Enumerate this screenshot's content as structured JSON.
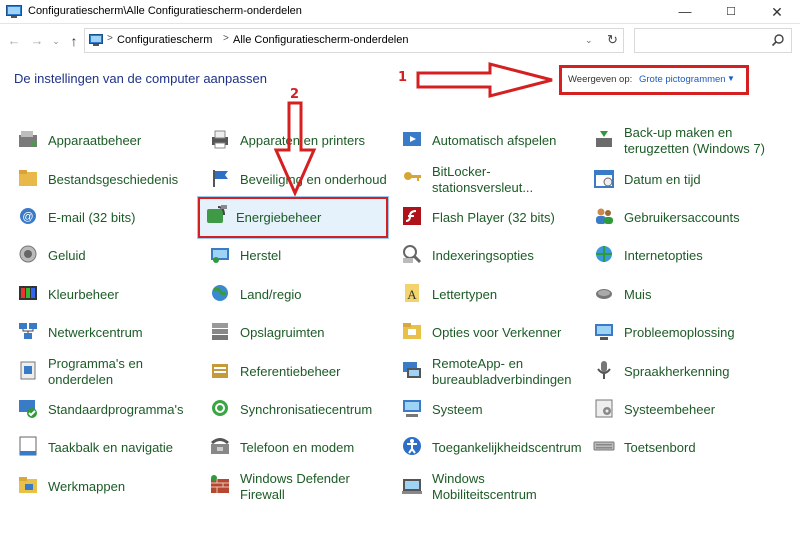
{
  "window": {
    "title": "Configuratiescherm\\Alle Configuratiescherm-onderdelen",
    "minimize": "—",
    "maximize": "☐",
    "close": "✕"
  },
  "address": {
    "back": "←",
    "forward": "→",
    "dropdown": "⌄",
    "up": "↑",
    "sep": ">",
    "crumbs": [
      "Configuratiescherm",
      "Alle Configuratiescherm-onderdelen"
    ],
    "refresh": "↻"
  },
  "search": {
    "placeholder": ""
  },
  "heading": "De instellingen van de computer aanpassen",
  "view_by": {
    "label": "Weergeven op:",
    "value": "Grote pictogrammen",
    "caret": "▼"
  },
  "annotations": {
    "one": "1",
    "two": "2"
  },
  "items": [
    {
      "label": "Apparaatbeheer",
      "icon": "device-manager-icon"
    },
    {
      "label": "Apparaten en printers",
      "icon": "printer-icon"
    },
    {
      "label": "Automatisch afspelen",
      "icon": "autoplay-icon"
    },
    {
      "label": "Back-up maken en terugzetten (Windows 7)",
      "icon": "backup-icon"
    },
    {
      "label": "Bestandsgeschiedenis",
      "icon": "file-history-icon"
    },
    {
      "label": "Beveiliging en onderhoud",
      "icon": "flag-icon"
    },
    {
      "label": "BitLocker-stationsversleut...",
      "icon": "key-icon"
    },
    {
      "label": "Datum en tijd",
      "icon": "calendar-icon"
    },
    {
      "label": "E-mail (32 bits)",
      "icon": "mail-icon"
    },
    {
      "label": "Energiebeheer",
      "icon": "power-icon"
    },
    {
      "label": "Flash Player (32 bits)",
      "icon": "flash-icon"
    },
    {
      "label": "Gebruikersaccounts",
      "icon": "users-icon"
    },
    {
      "label": "Geluid",
      "icon": "speaker-icon"
    },
    {
      "label": "Herstel",
      "icon": "recovery-icon"
    },
    {
      "label": "Indexeringsopties",
      "icon": "index-icon"
    },
    {
      "label": "Internetopties",
      "icon": "internet-icon"
    },
    {
      "label": "Kleurbeheer",
      "icon": "color-icon"
    },
    {
      "label": "Land/regio",
      "icon": "globe-icon"
    },
    {
      "label": "Lettertypen",
      "icon": "font-icon"
    },
    {
      "label": "Muis",
      "icon": "mouse-icon"
    },
    {
      "label": "Netwerkcentrum",
      "icon": "network-icon"
    },
    {
      "label": "Opslagruimten",
      "icon": "storage-icon"
    },
    {
      "label": "Opties voor Verkenner",
      "icon": "folder-options-icon"
    },
    {
      "label": "Probleemoplossing",
      "icon": "troubleshoot-icon"
    },
    {
      "label": "Programma's en onderdelen",
      "icon": "programs-icon"
    },
    {
      "label": "Referentiebeheer",
      "icon": "credential-icon"
    },
    {
      "label": "RemoteApp- en bureaubladverbindingen",
      "icon": "remote-icon"
    },
    {
      "label": "Spraakherkenning",
      "icon": "microphone-icon"
    },
    {
      "label": "Standaardprogramma's",
      "icon": "default-programs-icon"
    },
    {
      "label": "Synchronisatiecentrum",
      "icon": "sync-icon"
    },
    {
      "label": "Systeem",
      "icon": "system-icon"
    },
    {
      "label": "Systeembeheer",
      "icon": "admin-tools-icon"
    },
    {
      "label": "Taakbalk en navigatie",
      "icon": "taskbar-icon"
    },
    {
      "label": "Telefoon en modem",
      "icon": "phone-icon"
    },
    {
      "label": "Toegankelijkheidscentrum",
      "icon": "accessibility-icon"
    },
    {
      "label": "Toetsenbord",
      "icon": "keyboard-icon"
    },
    {
      "label": "Werkmappen",
      "icon": "work-folders-icon"
    },
    {
      "label": "Windows Defender Firewall",
      "icon": "firewall-icon"
    },
    {
      "label": "Windows Mobiliteitscentrum",
      "icon": "mobility-icon"
    }
  ],
  "colors": {
    "item_text": "#1c5b26",
    "heading": "#1e3287",
    "annotation": "#d42020",
    "link": "#1e5bbd"
  }
}
